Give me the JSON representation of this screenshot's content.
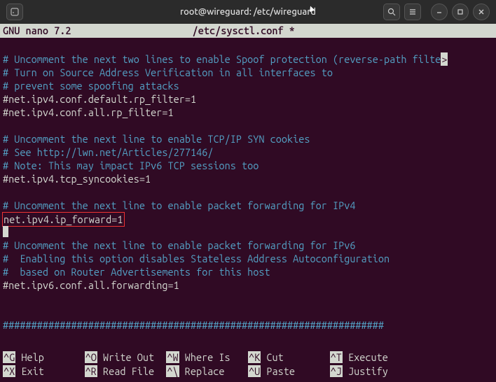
{
  "titlebar": {
    "left_icon": "terminal-icon",
    "title": "root@wireguard: /etc/wireguard",
    "search_icon": "search-icon",
    "menu_icon": "hamburger-icon",
    "min_icon": "minimize-icon",
    "max_icon": "maximize-icon",
    "close_icon": "close-icon"
  },
  "nano": {
    "app": "GNU nano 7.2",
    "filename": "/etc/sysctl.conf *"
  },
  "content": {
    "l1": "# Uncomment the next two lines to enable Spoof protection (reverse-path filte",
    "gt": ">",
    "l2": "# Turn on Source Address Verification in all interfaces to",
    "l3": "# prevent some spoofing attacks",
    "l4": "#net.ipv4.conf.default.rp_filter=1",
    "l5": "#net.ipv4.conf.all.rp_filter=1",
    "l6": "",
    "l7": "# Uncomment the next line to enable TCP/IP SYN cookies",
    "l8": "# See http://lwn.net/Articles/277146/",
    "l9": "# Note: This may impact IPv6 TCP sessions too",
    "l10": "#net.ipv4.tcp_syncookies=1",
    "l11": "",
    "l12": "# Uncomment the next line to enable packet forwarding for IPv4",
    "l13": "net.ipv4.ip_forward=1",
    "l14": "",
    "l15": "# Uncomment the next line to enable packet forwarding for IPv6",
    "l16": "#  Enabling this option disables Stateless Address Autoconfiguration",
    "l17": "#  based on Router Advertisements for this host",
    "l18": "#net.ipv6.conf.all.forwarding=1",
    "l19": "",
    "l20": "",
    "l21": "###################################################################"
  },
  "shortcuts": {
    "k1": "^G",
    "v1": "Help",
    "k2": "^O",
    "v2": "Write Out",
    "k3": "^W",
    "v3": "Where Is",
    "k4": "^K",
    "v4": "Cut",
    "k5": "^T",
    "v5": "Execute",
    "k6": "^X",
    "v6": "Exit",
    "k7": "^R",
    "v7": "Read File",
    "k8": "^\\",
    "v8": "Replace",
    "k9": "^U",
    "v9": "Paste",
    "k10": "^J",
    "v10": "Justify"
  }
}
